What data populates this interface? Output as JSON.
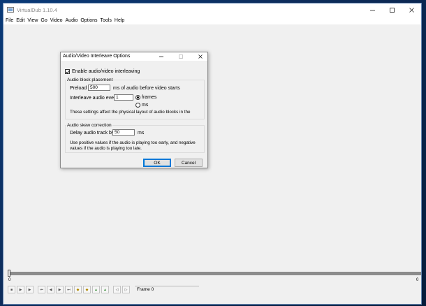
{
  "window": {
    "title": "VirtualDub 1.10.4",
    "menu": [
      "File",
      "Edit",
      "View",
      "Go",
      "Video",
      "Audio",
      "Options",
      "Tools",
      "Help"
    ]
  },
  "dialog": {
    "title": "Audio/Video Interleave Options",
    "enable_label": "Enable audio/video interleaving",
    "enable_checked": true,
    "block_group": "Audio block placement",
    "preload_label": "Preload",
    "preload_value": "500",
    "preload_suffix": "ms of audio before video starts",
    "interleave_label": "Interleave audio every",
    "interleave_value": "1",
    "frames_label": "frames",
    "ms_label": "ms",
    "selected_unit": "frames",
    "block_note": "These settings affect the physical layout of audio blocks in the",
    "skew_group": "Audio skew correction",
    "delay_label": "Delay audio track by",
    "delay_value": "50",
    "delay_suffix": "ms",
    "skew_note_1": "Use positive values if the audio is playing too early, and negative",
    "skew_note_2": "values if the audio is playing too late.",
    "ok_label": "OK",
    "cancel_label": "Cancel"
  },
  "position": {
    "start": "0",
    "end": "0",
    "frame_label": "Frame 0"
  }
}
